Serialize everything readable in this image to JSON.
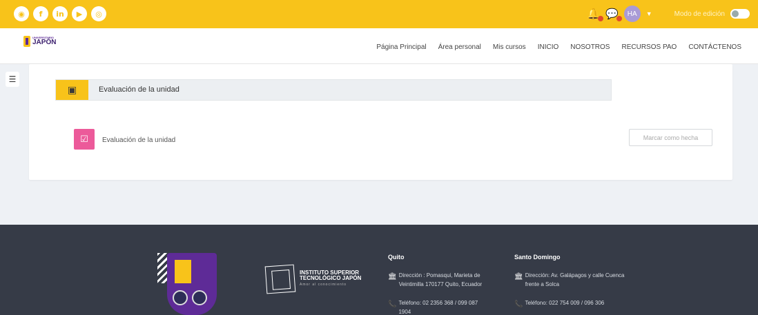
{
  "topbar": {
    "social_icons": [
      "globe-icon",
      "facebook-icon",
      "linkedin-icon",
      "youtube-icon",
      "instagram-icon"
    ],
    "social_glyphs": [
      "◉",
      "f",
      "in",
      "▶",
      "◎"
    ],
    "user_initials": "HA",
    "edit_mode_label": "Modo de edición"
  },
  "nav": {
    "logo_small": "UNIVERSITARIO",
    "logo_big": "JAPÓN",
    "items": [
      "Página Principal",
      "Área personal",
      "Mis cursos",
      "INICIO",
      "NOSOTROS",
      "RECURSOS PAO",
      "CONTÁCTENOS"
    ]
  },
  "course": {
    "section_title": "Evaluación de la unidad",
    "activity_name": "Evaluación de la unidad",
    "mark_done_label": "Marcar como hecha"
  },
  "footer": {
    "inst_line1": "INSTITUTO SUPERIOR",
    "inst_line2": "TECNOLÓGICO JAPÓN",
    "inst_tagline": "Amor al conocimiento",
    "quito": {
      "city": "Quito",
      "address": "Dirección : Pomasqui, Marieta de Veintimilla 170177 Quito, Ecuador",
      "phone": "Teléfono: 02 2356 368 / 099 087 1904"
    },
    "santo_domingo": {
      "city": "Santo Domingo",
      "address": "Dirección: Av. Galápagos y calle Cuenca frente a Solca",
      "phone": "Teléfono: 022 754 009 / 096 306"
    }
  },
  "colors": {
    "brand_yellow": "#f8c31a",
    "brand_purple": "#5e2b97",
    "footer_bg": "#363b47",
    "activity_pink": "#ec5a9a"
  }
}
